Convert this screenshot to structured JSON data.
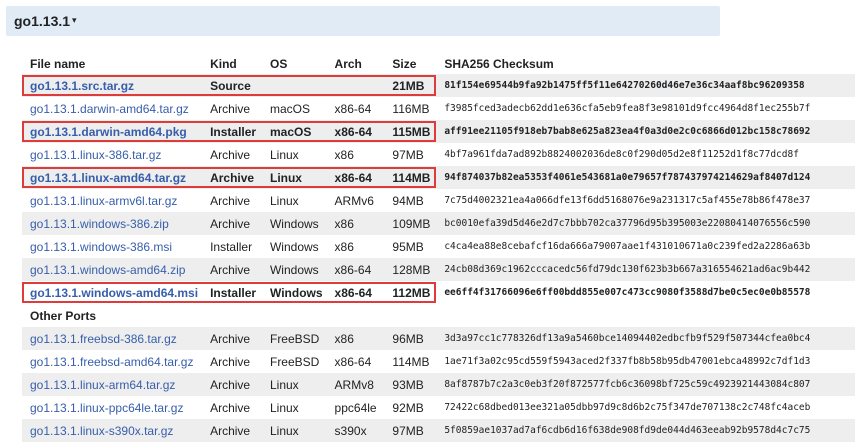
{
  "version": {
    "title": "go1.13.1",
    "caret": "▾"
  },
  "columns": {
    "file": "File name",
    "kind": "Kind",
    "os": "OS",
    "arch": "Arch",
    "size": "Size",
    "sha": "SHA256 Checksum"
  },
  "section_other": "Other Ports",
  "rows": [
    {
      "file": "go1.13.1.src.tar.gz",
      "kind": "Source",
      "os": "",
      "arch": "",
      "size": "21MB",
      "sha": "81f154e69544b9fa92b1475ff5f11e64270260d46e7e36c34aaf8bc96209358",
      "highlighted": true
    },
    {
      "file": "go1.13.1.darwin-amd64.tar.gz",
      "kind": "Archive",
      "os": "macOS",
      "arch": "x86-64",
      "size": "116MB",
      "sha": "f3985fced3adecb62dd1e636cfa5eb9fea8f3e98101d9fcc4964d8f1ec255b7f",
      "highlighted": false
    },
    {
      "file": "go1.13.1.darwin-amd64.pkg",
      "kind": "Installer",
      "os": "macOS",
      "arch": "x86-64",
      "size": "115MB",
      "sha": "aff91ee21105f918eb7bab8e625a823ea4f0a3d0e2c0c6866d012bc158c78692",
      "highlighted": true
    },
    {
      "file": "go1.13.1.linux-386.tar.gz",
      "kind": "Archive",
      "os": "Linux",
      "arch": "x86",
      "size": "97MB",
      "sha": "4bf7a961fda7ad892b8824002036de8c0f290d05d2e8f11252d1f8c77dcd8f",
      "highlighted": false
    },
    {
      "file": "go1.13.1.linux-amd64.tar.gz",
      "kind": "Archive",
      "os": "Linux",
      "arch": "x86-64",
      "size": "114MB",
      "sha": "94f874037b82ea5353f4061e543681a0e79657f787437974214629af8407d124",
      "highlighted": true
    },
    {
      "file": "go1.13.1.linux-armv6l.tar.gz",
      "kind": "Archive",
      "os": "Linux",
      "arch": "ARMv6",
      "size": "94MB",
      "sha": "7c75d4002321ea4a066dfe13f6dd5168076e9a231317c5af455e78b86f478e37",
      "highlighted": false
    },
    {
      "file": "go1.13.1.windows-386.zip",
      "kind": "Archive",
      "os": "Windows",
      "arch": "x86",
      "size": "109MB",
      "sha": "bc0010efa39d5d46e2d7c7bbb702ca37796d95b395003e22080414076556c590",
      "highlighted": false
    },
    {
      "file": "go1.13.1.windows-386.msi",
      "kind": "Installer",
      "os": "Windows",
      "arch": "x86",
      "size": "95MB",
      "sha": "c4ca4ea88e8cebafcf16da666a79007aae1f431010671a0c239fed2a2286a63b",
      "highlighted": false
    },
    {
      "file": "go1.13.1.windows-amd64.zip",
      "kind": "Archive",
      "os": "Windows",
      "arch": "x86-64",
      "size": "128MB",
      "sha": "24cb08d369c1962cccacedc56fd79dc130f623b3b667a316554621ad6ac9b442",
      "highlighted": false
    },
    {
      "file": "go1.13.1.windows-amd64.msi",
      "kind": "Installer",
      "os": "Windows",
      "arch": "x86-64",
      "size": "112MB",
      "sha": "ee6ff4f31766096e6ff00bdd855e007c473cc9080f3588d7be0c5ec0e0b85578",
      "highlighted": true
    }
  ],
  "other_rows": [
    {
      "file": "go1.13.1.freebsd-386.tar.gz",
      "kind": "Archive",
      "os": "FreeBSD",
      "arch": "x86",
      "size": "96MB",
      "sha": "3d3a97cc1c778326df13a9a5460bce14094402edbcfb9f529f507344cfea0bc4"
    },
    {
      "file": "go1.13.1.freebsd-amd64.tar.gz",
      "kind": "Archive",
      "os": "FreeBSD",
      "arch": "x86-64",
      "size": "114MB",
      "sha": "1ae71f3a02c95cd559f5943aced2f337fb8b58b95db47001ebca48992c7df1d3"
    },
    {
      "file": "go1.13.1.linux-arm64.tar.gz",
      "kind": "Archive",
      "os": "Linux",
      "arch": "ARMv8",
      "size": "93MB",
      "sha": "8af8787b7c2a3c0eb3f20f872577fcb6c36098bf725c59c4923921443084c807"
    },
    {
      "file": "go1.13.1.linux-ppc64le.tar.gz",
      "kind": "Archive",
      "os": "Linux",
      "arch": "ppc64le",
      "size": "92MB",
      "sha": "72422c68dbed013ee321a05dbb97d9c8d6b2c75f347de707138c2c748fc4aceb"
    },
    {
      "file": "go1.13.1.linux-s390x.tar.gz",
      "kind": "Archive",
      "os": "Linux",
      "arch": "s390x",
      "size": "97MB",
      "sha": "5f0859ae1037ad7af6cdb6d16f638de908fd9de044d463eeab92b9578d4c7c75"
    }
  ],
  "colors": {
    "header_bg": "#e0ebf5",
    "link": "#375eab",
    "row_alt": "#eeeeee",
    "highlight_border": "#e03b3b"
  }
}
